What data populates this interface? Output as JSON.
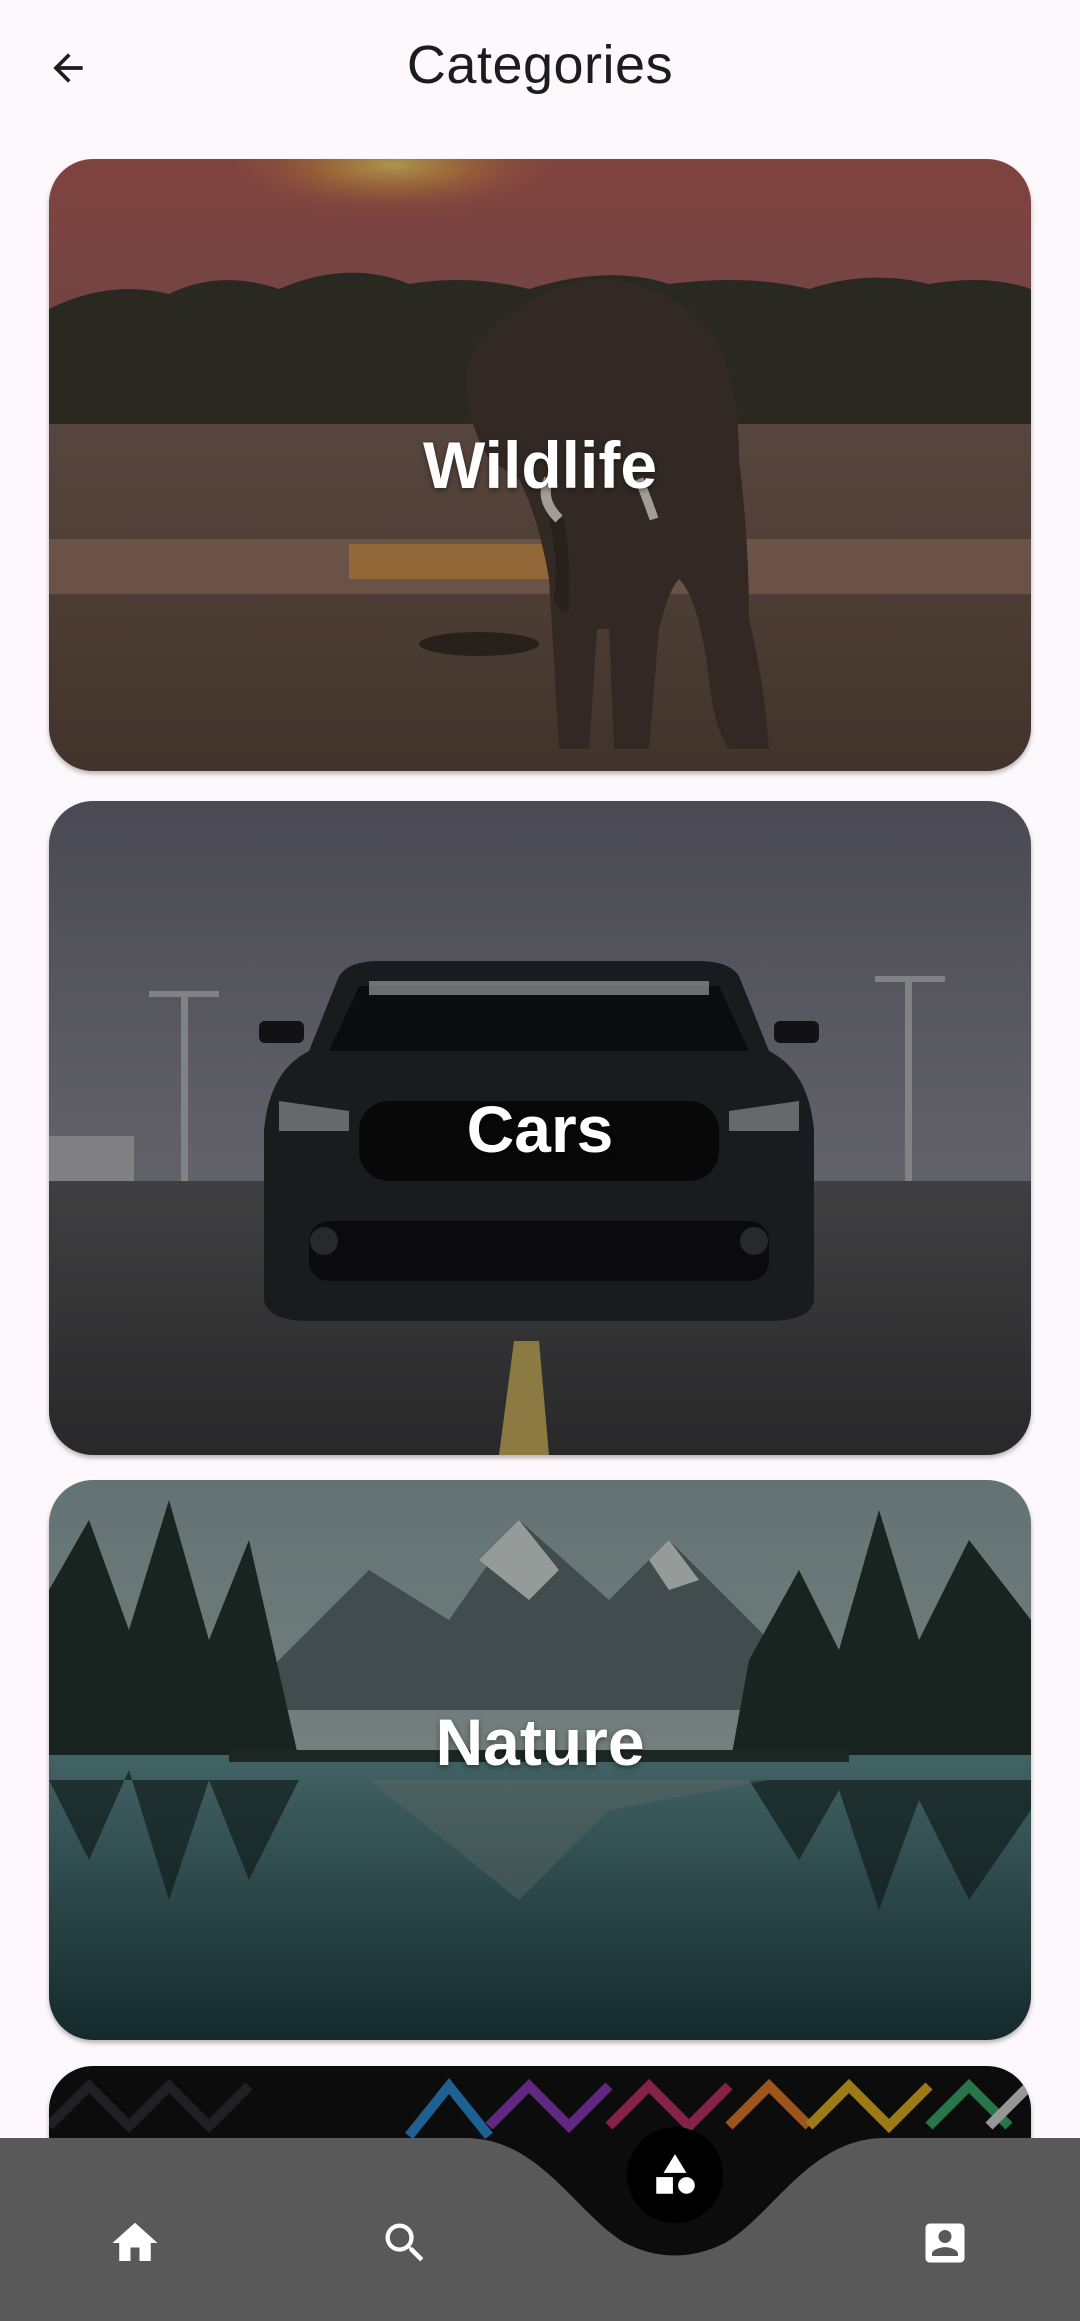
{
  "header": {
    "title": "Categories",
    "back_icon": "arrow-back-icon"
  },
  "categories": [
    {
      "label": "Wildlife",
      "image": "elephant-at-sunset"
    },
    {
      "label": "Cars",
      "image": "black-mustang-on-road"
    },
    {
      "label": "Nature",
      "image": "mountain-lake-reflection"
    },
    {
      "label": "",
      "image": "colorful-geometric-pattern"
    }
  ],
  "bottom_nav": {
    "items": [
      {
        "icon": "home-icon"
      },
      {
        "icon": "search-icon"
      },
      {
        "icon": "categories-icon",
        "selected": true
      },
      {
        "icon": "profile-icon"
      }
    ]
  },
  "colors": {
    "background": "#fdf8fb",
    "nav_bar": "#595959",
    "fab": "#000000",
    "title_text": "#1c1b1f"
  }
}
